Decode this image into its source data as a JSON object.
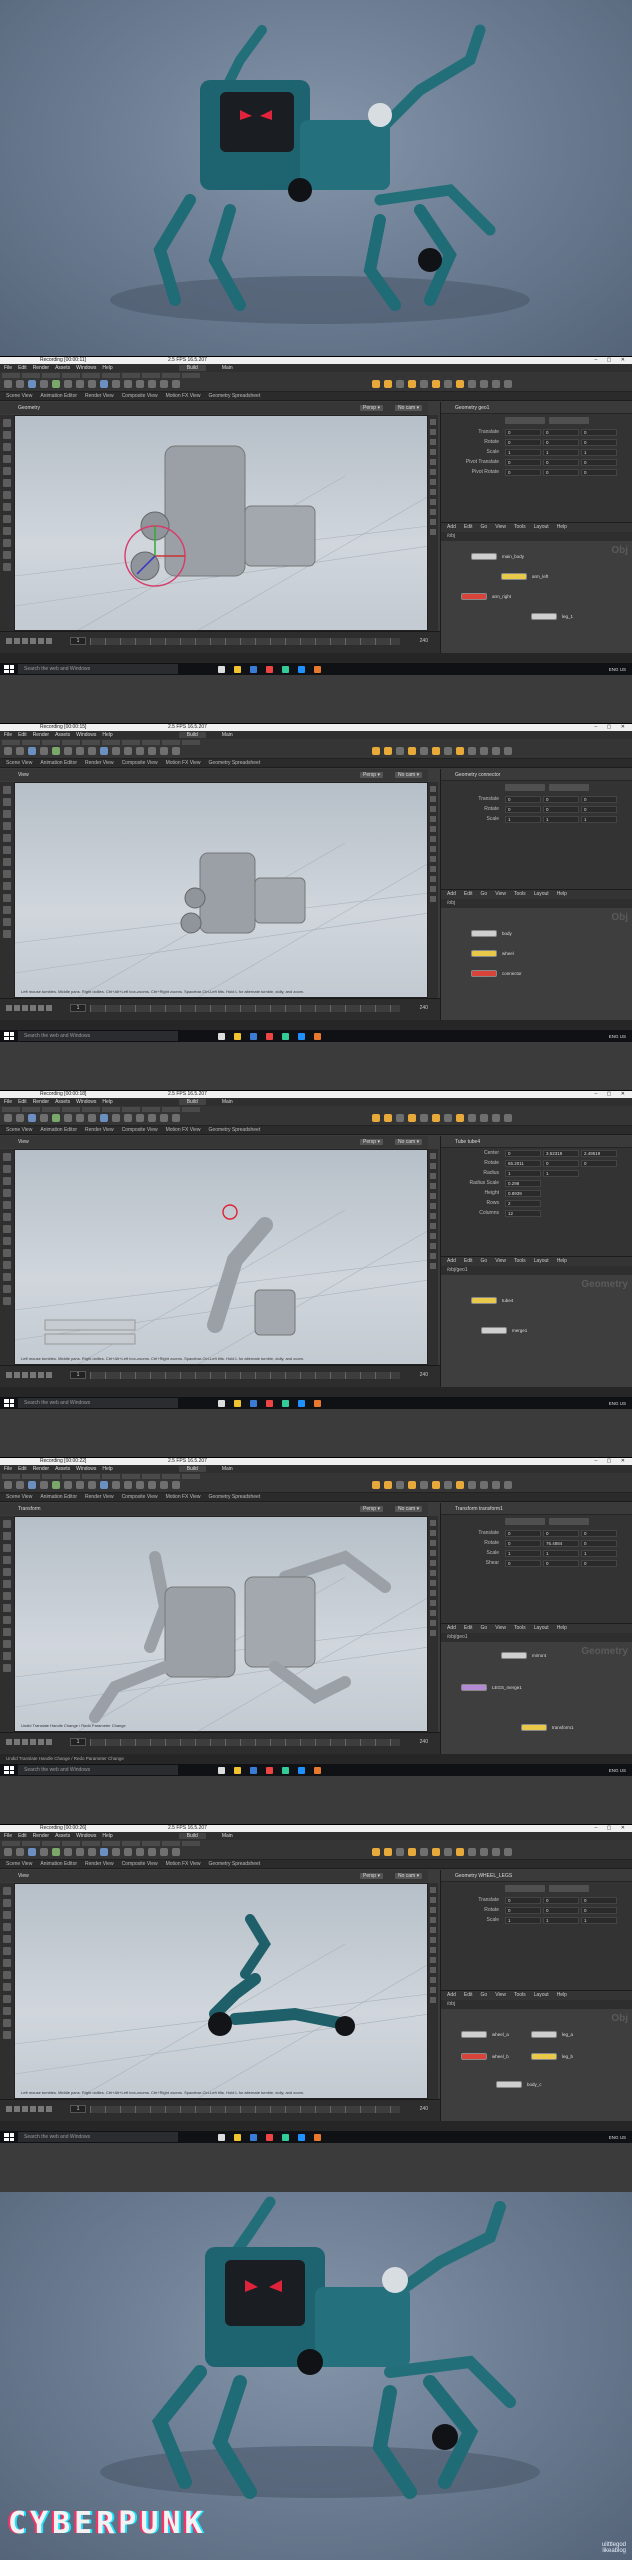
{
  "logo_text": "CYBERPUNK",
  "watermark": "ulittlegod\nlikeablog",
  "screens": [
    {
      "title": "Recording [00:00:11]",
      "fps": "2.5 FPS 16.5.207",
      "menu": [
        "File",
        "Edit",
        "Render",
        "Assets",
        "Windows",
        "Help"
      ],
      "desktop": "Build",
      "main_label": "Main",
      "viewport_label": "Geometry",
      "param_node": "Geometry  geo1",
      "params": [
        {
          "label": "Translate",
          "values": [
            "0",
            "0",
            "0"
          ]
        },
        {
          "label": "Rotate",
          "values": [
            "0",
            "0",
            "0"
          ]
        },
        {
          "label": "Scale",
          "values": [
            "1",
            "1",
            "1"
          ]
        },
        {
          "label": "Pivot Translate",
          "values": [
            "0",
            "0",
            "0"
          ]
        },
        {
          "label": "Pivot Rotate",
          "values": [
            "0",
            "0",
            "0"
          ]
        }
      ],
      "frame": "1",
      "end_frame": "240",
      "network_context": "Obj",
      "nodes": [
        "main_body",
        "arm_left",
        "arm_right",
        "leg_1"
      ],
      "status": ""
    },
    {
      "title": "Recording [00:00:15]",
      "fps": "2.5 FPS 16.5.207",
      "menu": [
        "File",
        "Edit",
        "Render",
        "Assets",
        "Windows",
        "Help"
      ],
      "desktop": "Build",
      "main_label": "Main",
      "viewport_label": "View",
      "param_node": "Geometry  connector",
      "params": [
        {
          "label": "Translate",
          "values": [
            "0",
            "0",
            "0"
          ]
        },
        {
          "label": "Rotate",
          "values": [
            "0",
            "0",
            "0"
          ]
        },
        {
          "label": "Scale",
          "values": [
            "1",
            "1",
            "1"
          ]
        }
      ],
      "frame": "1",
      "end_frame": "240",
      "network_context": "Obj",
      "nodes": [
        "body",
        "wheel",
        "connector"
      ],
      "status": "Left mouse tumbles. Middle pans. Right dollies. Ctrl+Alt+Left box-zooms. Ctrl+Right zooms. Spacebar-Ctrl-Left tilts. Hold L for alternate tumble, dolly, and zoom."
    },
    {
      "title": "Recording [00:00:18]",
      "fps": "2.5 FPS 16.5.207",
      "menu": [
        "File",
        "Edit",
        "Render",
        "Assets",
        "Windows",
        "Help"
      ],
      "desktop": "Build",
      "main_label": "Main",
      "viewport_label": "View",
      "param_node": "Tube  tube4",
      "params": [
        {
          "label": "Center",
          "values": [
            "0",
            "3.52319",
            "2.49519"
          ]
        },
        {
          "label": "Rotate",
          "values": [
            "65.2011",
            "0",
            "0"
          ]
        },
        {
          "label": "Radius",
          "values": [
            "1",
            "1",
            ""
          ]
        },
        {
          "label": "Radius Scale",
          "values": [
            "0.298",
            "",
            ""
          ]
        },
        {
          "label": "Height",
          "values": [
            "0.8939",
            "",
            ""
          ]
        },
        {
          "label": "Rows",
          "values": [
            "2",
            "",
            ""
          ]
        },
        {
          "label": "Columns",
          "values": [
            "12",
            "",
            ""
          ]
        }
      ],
      "frame": "1",
      "end_frame": "240",
      "network_context": "Geometry",
      "nodes": [
        "tube4",
        "merge1"
      ],
      "status": "Left mouse tumbles. Middle pans. Right dollies. Ctrl+Alt+Left box-zooms. Ctrl+Right zooms. Spacebar-Ctrl-Left tilts. Hold L for alternate tumble, dolly, and zoom."
    },
    {
      "title": "Recording [00:00:22]",
      "fps": "2.5 FPS 16.5.207",
      "menu": [
        "File",
        "Edit",
        "Render",
        "Assets",
        "Windows",
        "Help"
      ],
      "desktop": "Build",
      "main_label": "Main",
      "viewport_label": "Transform",
      "param_node": "Transform  transform1",
      "params": [
        {
          "label": "Translate",
          "values": [
            "0",
            "0",
            "0"
          ]
        },
        {
          "label": "Rotate",
          "values": [
            "0",
            "76.4884",
            "0"
          ]
        },
        {
          "label": "Scale",
          "values": [
            "1",
            "1",
            "1"
          ]
        },
        {
          "label": "Shear",
          "values": [
            "0",
            "0",
            "0"
          ]
        }
      ],
      "frame": "1",
      "end_frame": "240",
      "network_context": "Geometry",
      "nodes": [
        "mirror4",
        "LEGS_merge1",
        "transform1"
      ],
      "status": "Undid Translate Handle Change / Redo Parameter Change"
    },
    {
      "title": "Recording [00:00:26]",
      "fps": "2.5 FPS 16.5.207",
      "menu": [
        "File",
        "Edit",
        "Render",
        "Assets",
        "Windows",
        "Help"
      ],
      "desktop": "Build",
      "main_label": "Main",
      "viewport_label": "View",
      "param_node": "Geometry  WHEEL_LEGS",
      "params": [
        {
          "label": "Translate",
          "values": [
            "0",
            "0",
            "0"
          ]
        },
        {
          "label": "Rotate",
          "values": [
            "0",
            "0",
            "0"
          ]
        },
        {
          "label": "Scale",
          "values": [
            "1",
            "1",
            "1"
          ]
        }
      ],
      "frame": "1",
      "end_frame": "240",
      "network_context": "Obj",
      "nodes": [
        "wheel_a",
        "wheel_b",
        "leg_a",
        "leg_b",
        "body_c"
      ],
      "status": "Left mouse tumbles. Middle pans. Right dollies. Ctrl+Alt+Left box-zooms. Ctrl+Right zooms. Spacebar-Ctrl-Left tilts. Hold L for alternate tumble, dolly, and zoom."
    }
  ],
  "taskbar_search": "Search the web and Windows",
  "taskbar_tray": "ENG\nUS"
}
